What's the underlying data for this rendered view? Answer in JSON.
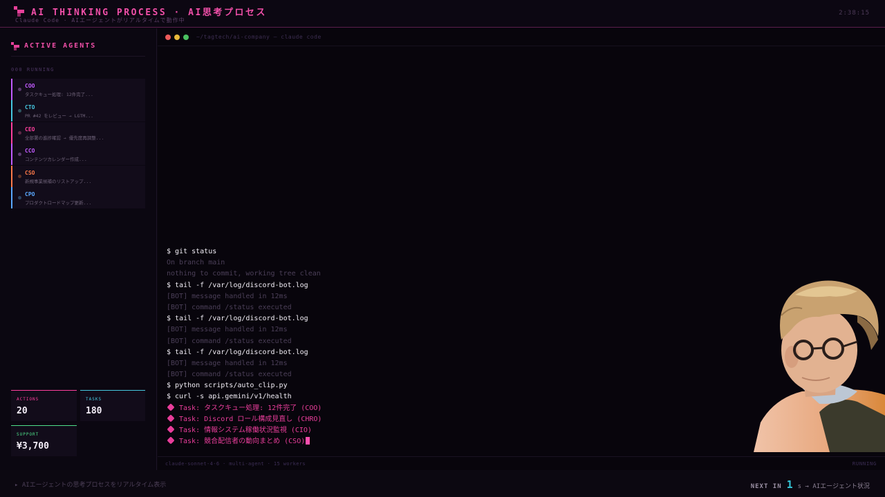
{
  "header": {
    "title": "AI THINKING PROCESS · AI思考プロセス",
    "subtitle": "Claude Code · AIエージェントがリアルタイムで動作中",
    "clock": "2:38:15"
  },
  "sidebar": {
    "title": "ACTIVE AGENTS",
    "running_label": "000 RUNNING",
    "agents": [
      {
        "name": "COO",
        "status": "タスクキュー処理: 12件完了...",
        "color": "#c25bff",
        "dot": "#5a3a6e"
      },
      {
        "name": "CTO",
        "status": "PR #42 をレビュー → LGTM...",
        "color": "#46c8e0",
        "dot": "#2e5560"
      },
      {
        "name": "CEO",
        "status": "全部署の進捗確認 → 優先度再調整...",
        "color": "#ff3f9e",
        "dot": "#5e2746"
      },
      {
        "name": "CCO",
        "status": "コンテンツカレンダー作成...",
        "color": "#c25bff",
        "dot": "#5a3a6e"
      },
      {
        "name": "CSO",
        "status": "新規事業候補のリストアップ...",
        "color": "#ff7a4a",
        "dot": "#5e3226"
      },
      {
        "name": "CPO",
        "status": "プロダクトロードマップ更新...",
        "color": "#5aa8ff",
        "dot": "#2b4360"
      }
    ],
    "stats": [
      {
        "label": "ACTIONS",
        "value": "20",
        "color": "#ff3f9e"
      },
      {
        "label": "TASKS",
        "value": "180",
        "color": "#46c8e0"
      },
      {
        "label": "SUPPORT",
        "value": "¥3,700",
        "color": "#4ee08a"
      }
    ]
  },
  "terminal": {
    "path": "~/tagtech/ai-company — claude code",
    "lines": [
      {
        "type": "cmd",
        "text": "$ git status"
      },
      {
        "type": "out",
        "text": "On branch main"
      },
      {
        "type": "out",
        "text": "nothing to commit, working tree clean"
      },
      {
        "type": "cmd",
        "text": "$ tail -f /var/log/discord-bot.log"
      },
      {
        "type": "out",
        "text": "[BOT] message handled in 12ms"
      },
      {
        "type": "out",
        "text": "[BOT] command /status executed"
      },
      {
        "type": "cmd",
        "text": "$ tail -f /var/log/discord-bot.log"
      },
      {
        "type": "out",
        "text": "[BOT] message handled in 12ms"
      },
      {
        "type": "out",
        "text": "[BOT] command /status executed"
      },
      {
        "type": "cmd",
        "text": "$ tail -f /var/log/discord-bot.log"
      },
      {
        "type": "out",
        "text": "[BOT] message handled in 12ms"
      },
      {
        "type": "out",
        "text": "[BOT] command /status executed"
      },
      {
        "type": "cmd",
        "text": "$ python scripts/auto_clip.py"
      },
      {
        "type": "cmd",
        "text": "$ curl -s api.gemini/v1/health"
      },
      {
        "type": "task",
        "text": "Task: タスクキュー処理: 12件完了 (COO)"
      },
      {
        "type": "task",
        "text": "Task: Discord ロール構成見直し (CHRO)"
      },
      {
        "type": "task",
        "text": "Task: 情報システム稼働状況監視 (CIO)"
      },
      {
        "type": "task",
        "text": "Task: 競合配信者の動向まとめ (CSO)",
        "cursor": true
      }
    ],
    "footer_left": "claude-sonnet-4-6 · multi-agent · 15 workers",
    "footer_right": "RUNNING"
  },
  "bottom": {
    "ticker": "▸ AIエージェントの思考プロセスをリアルタイム表示",
    "next_label": "NEXT IN",
    "next_value": "1",
    "next_suffix": "s → AIエージェント状況"
  }
}
